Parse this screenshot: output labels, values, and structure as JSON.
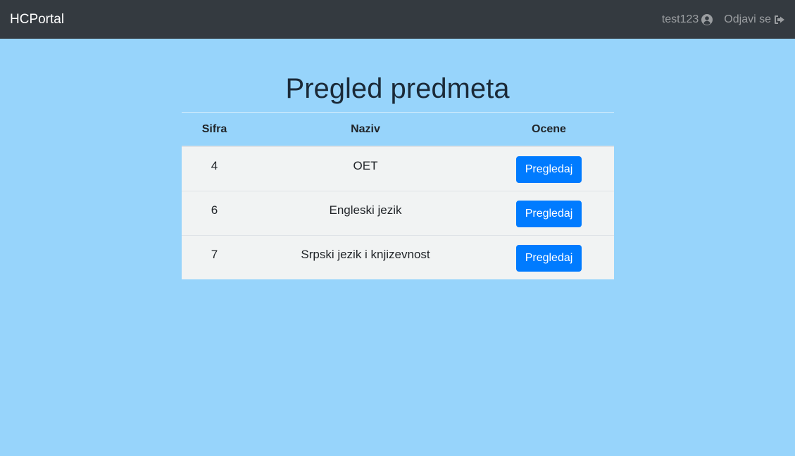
{
  "navbar": {
    "brand": "HCPortal",
    "user_label": "test123",
    "user_icon": "user-circle-icon",
    "logout_label": "Odjavi se",
    "logout_icon": "sign-out-icon"
  },
  "page": {
    "title": "Pregled predmeta"
  },
  "table": {
    "columns": [
      "Sifra",
      "Naziv",
      "Ocene"
    ],
    "rows": [
      {
        "sifra": "4",
        "naziv": "OET",
        "action": "Pregledaj"
      },
      {
        "sifra": "6",
        "naziv": "Engleski jezik",
        "action": "Pregledaj"
      },
      {
        "sifra": "7",
        "naziv": "Srpski jezik i knjizevnost",
        "action": "Pregledaj"
      }
    ]
  },
  "colors": {
    "navbar_bg": "#343a40",
    "page_bg": "#97d4fb",
    "button_bg": "#007bff",
    "row_bg": "#f1f3f3"
  }
}
